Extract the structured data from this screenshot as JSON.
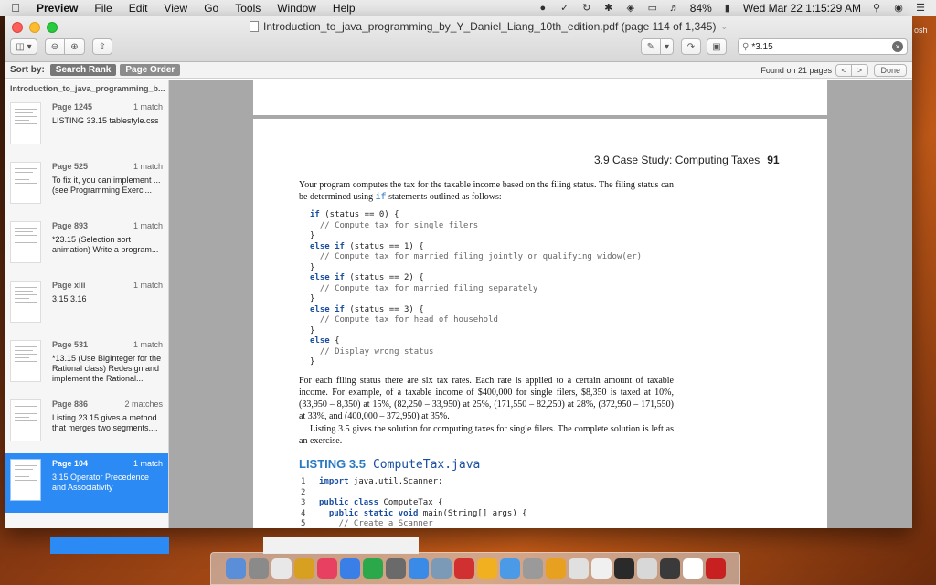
{
  "menubar": {
    "app": "Preview",
    "items": [
      "File",
      "Edit",
      "View",
      "Go",
      "Tools",
      "Window",
      "Help"
    ],
    "battery": "84%",
    "clock": "Wed Mar 22  1:15:29 AM"
  },
  "window": {
    "title": "Introduction_to_java_programming_by_Y_Daniel_Liang_10th_edition.pdf (page 114 of 1,345)",
    "search_value": "*3.15",
    "sort_label": "Sort by:",
    "sort_rank": "Search Rank",
    "sort_order": "Page Order",
    "found": "Found on 21 pages",
    "done": "Done",
    "prev": "<",
    "next": ">"
  },
  "sidebar": {
    "doc_name": "Introduction_to_java_programming_b...",
    "results": [
      {
        "page": "Page 1245",
        "matches": "1 match",
        "text": "LISTING 33.15 tablestyle.css"
      },
      {
        "page": "Page 525",
        "matches": "1 match",
        "text": "To fix it, you can implement ... (see Programming Exerci..."
      },
      {
        "page": "Page 893",
        "matches": "1 match",
        "text": "*23.15 (Selection sort animation) Write a program..."
      },
      {
        "page": "Page xiii",
        "matches": "1 match",
        "text": "3.15 3.16"
      },
      {
        "page": "Page 531",
        "matches": "1 match",
        "text": "*13.15 (Use BigInteger for the Rational class) Redesign and implement the Rational..."
      },
      {
        "page": "Page 886",
        "matches": "2 matches",
        "text": "Listing 23.15 gives a method that merges two segments...."
      },
      {
        "page": "Page 104",
        "matches": "1 match",
        "text": "3.15 Operator Precedence and Associativity"
      }
    ]
  },
  "page": {
    "header_section": "3.9  Case Study: Computing Taxes",
    "header_num": "91",
    "para1_a": "Your program computes the tax for the taxable income based on the filing status. The filing status can be determined using",
    "para1_code": "if",
    "para1_b": "statements outlined as follows:",
    "code_lines": [
      {
        "kw": "if",
        "rest": " (status == 0) {"
      },
      {
        "cm": "  // Compute tax for single filers"
      },
      {
        "rest": "}"
      },
      {
        "kw": "else if",
        "rest": " (status == 1) {"
      },
      {
        "cm": "  // Compute tax for married filing jointly or qualifying widow(er)"
      },
      {
        "rest": "}"
      },
      {
        "kw": "else if",
        "rest": " (status == 2) {"
      },
      {
        "cm": "  // Compute tax for married filing separately"
      },
      {
        "rest": "}"
      },
      {
        "kw": "else if",
        "rest": " (status == 3) {"
      },
      {
        "cm": "  // Compute tax for head of household"
      },
      {
        "rest": "}"
      },
      {
        "kw": "else",
        "rest": " {"
      },
      {
        "cm": "  // Display wrong status"
      },
      {
        "rest": "}"
      }
    ],
    "para2": "For each filing status there are six tax rates. Each rate is applied to a certain amount of taxable income. For example, of a taxable income of $400,000 for single filers, $8,350 is taxed at 10%, (33,950 – 8,350) at 15%, (82,250 – 33,950) at 25%, (171,550 – 82,250) at 28%, (372,950 – 171,550) at 33%, and (400,000 – 372,950) at 35%.",
    "para3": "Listing 3.5 gives the solution for computing taxes for single filers. The complete solution is left as an exercise.",
    "listing_label": "LISTING 3.5",
    "listing_file": "ComputeTax.java",
    "listing_lines": [
      {
        "n": "1",
        "kw": "import",
        "rest": " java.util.Scanner;"
      },
      {
        "n": "2",
        "rest": ""
      },
      {
        "n": "3",
        "kw": "public class",
        "rest": " ComputeTax {"
      },
      {
        "n": "4",
        "kw": "  public static void",
        "rest": " main(String[] args) {"
      },
      {
        "n": "5",
        "cm": "    // Create a Scanner"
      }
    ]
  },
  "dock_colors": [
    "#5a8ed8",
    "#8a8a8a",
    "#e8e8e8",
    "#d8a020",
    "#e84060",
    "#3a7ee8",
    "#2aa84a",
    "#6a6a6a",
    "#3a8ae8",
    "#7a9ab8",
    "#d03030",
    "#f0b020",
    "#4a9ae8",
    "#9a9a9a",
    "#e8a020",
    "#e0e0e0",
    "#f0f0f0",
    "#2a2a2a",
    "#d8d8d8",
    "#3a3a3a",
    "#ffffff",
    "#c82020"
  ]
}
